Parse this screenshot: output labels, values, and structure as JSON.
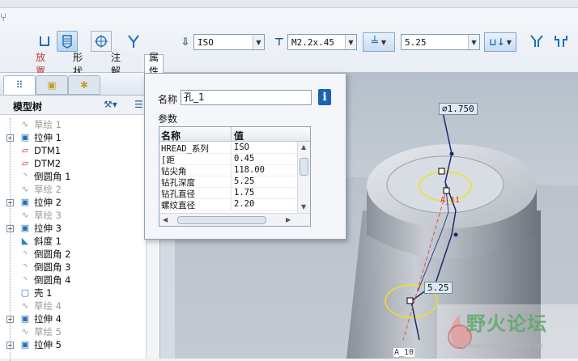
{
  "ribbon": {
    "thread_type": "ISO",
    "screw_size": "M2.2x.45",
    "depth_value": "5.25"
  },
  "tabs": [
    {
      "label": "放置",
      "selected": false,
      "color": "#c0392b"
    },
    {
      "label": "形状",
      "selected": false
    },
    {
      "label": "注解",
      "selected": false
    },
    {
      "label": "属性",
      "selected": true
    }
  ],
  "left_panel": {
    "title": "模型树",
    "tree": [
      {
        "label": "草绘 1",
        "dim": true,
        "expander": false,
        "icon": "sketch-icon"
      },
      {
        "label": "拉伸 1",
        "dim": false,
        "expander": true,
        "icon": "extrude-icon"
      },
      {
        "label": "DTM1",
        "dim": false,
        "expander": false,
        "icon": "datum-plane-icon"
      },
      {
        "label": "DTM2",
        "dim": false,
        "expander": false,
        "icon": "datum-plane-icon"
      },
      {
        "label": "倒圆角 1",
        "dim": false,
        "expander": false,
        "icon": "round-icon"
      },
      {
        "label": "草绘 2",
        "dim": true,
        "expander": false,
        "icon": "sketch-icon"
      },
      {
        "label": "拉伸 2",
        "dim": false,
        "expander": true,
        "icon": "extrude-icon"
      },
      {
        "label": "草绘 3",
        "dim": true,
        "expander": false,
        "icon": "sketch-icon"
      },
      {
        "label": "拉伸 3",
        "dim": false,
        "expander": true,
        "icon": "extrude-icon"
      },
      {
        "label": "斜度 1",
        "dim": false,
        "expander": false,
        "icon": "draft-icon"
      },
      {
        "label": "倒圆角 2",
        "dim": false,
        "expander": false,
        "icon": "round-icon"
      },
      {
        "label": "倒圆角 3",
        "dim": false,
        "expander": false,
        "icon": "round-icon"
      },
      {
        "label": "倒圆角 4",
        "dim": false,
        "expander": false,
        "icon": "round-icon"
      },
      {
        "label": "壳 1",
        "dim": false,
        "expander": false,
        "icon": "shell-icon"
      },
      {
        "label": "草绘 4",
        "dim": true,
        "expander": false,
        "icon": "sketch-icon"
      },
      {
        "label": "拉伸 4",
        "dim": false,
        "expander": true,
        "icon": "extrude-icon"
      },
      {
        "label": "草绘 5",
        "dim": true,
        "expander": false,
        "icon": "sketch-icon"
      },
      {
        "label": "拉伸 5",
        "dim": false,
        "expander": true,
        "icon": "extrude-icon"
      }
    ]
  },
  "properties": {
    "name_label": "名称",
    "name_value": "孔_1",
    "params_label": "参数",
    "col_name": "名称",
    "col_value": "值",
    "rows": [
      {
        "name": "HREAD_系列",
        "value": "ISO"
      },
      {
        "name": "[距",
        "value": "0.45"
      },
      {
        "name": "钻尖角",
        "value": "118.00"
      },
      {
        "name": "钻孔深度",
        "value": "5.25"
      },
      {
        "name": "钻孔直径",
        "value": "1.75"
      },
      {
        "name": "螺纹直径",
        "value": "2.20"
      }
    ]
  },
  "viewport": {
    "dim_diameter": "⌀1.750",
    "dim_depth": "5.25",
    "axis_label_1": "A_11",
    "axis_label_2": "A_10",
    "watermark_text": "野火论坛",
    "watermark_url": "www.proewildfire.cn"
  }
}
